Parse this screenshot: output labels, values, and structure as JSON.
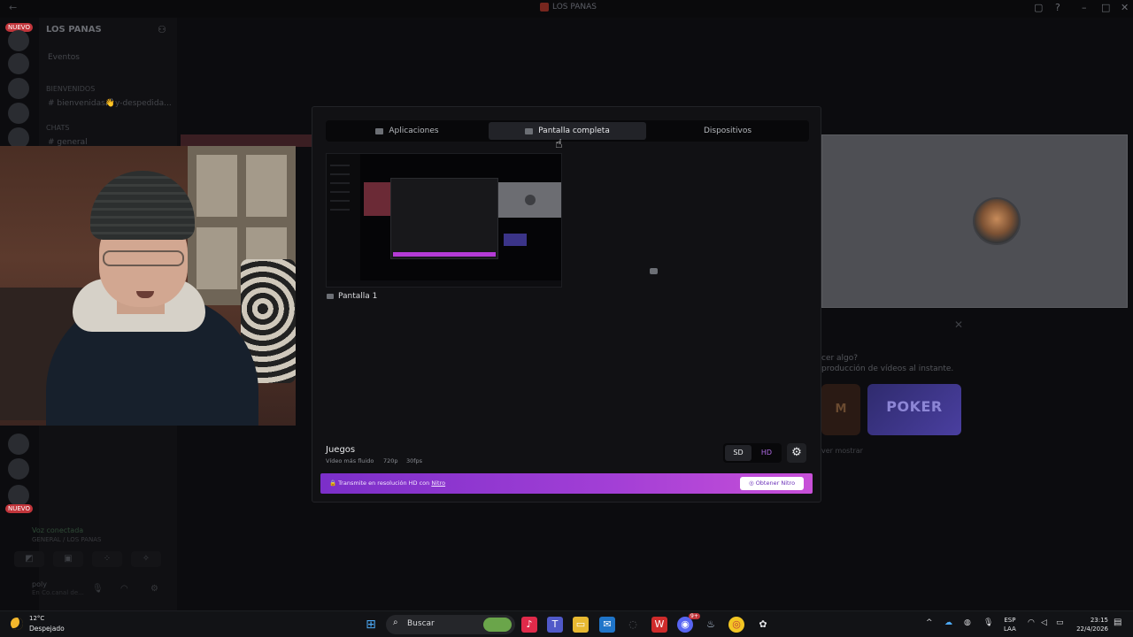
{
  "window": {
    "title": "LOS PANAS"
  },
  "sidebar": {
    "server_name": "LOS PANAS",
    "new_badge": "NUEVO",
    "new_badge_bottom": "NUEVO",
    "events": "Eventos",
    "category_welcome": "BIENVENIDOS",
    "welcome_channel": "bienvenidas👋y-despedida...",
    "category_chats": "CHATS",
    "general_channel": "general"
  },
  "voice_panel": {
    "status": "Voz conectada",
    "channel": "GENERAL / LOS PANAS",
    "username": "poly",
    "user_status": "En Co.canal de..."
  },
  "background": {
    "activity_line1": "cer algo?",
    "activity_line2": "producción de vídeos al instante.",
    "card1_text": "M",
    "card2_text": "POKER",
    "show_more": "ver mostrar"
  },
  "modal": {
    "tabs": [
      {
        "label": "Aplicaciones",
        "icon": "app-window-icon"
      },
      {
        "label": "Pantalla completa",
        "icon": "monitor-icon",
        "active": true
      },
      {
        "label": "Dispositivos",
        "icon": "camera-icon"
      }
    ],
    "screen_label": "Pantalla 1",
    "section_title": "Juegos",
    "quality_info": [
      "Vídeo más fluido",
      "720p",
      "30fps"
    ],
    "quality_options": {
      "sd": "SD",
      "hd": "HD",
      "selected": "SD"
    },
    "nitro_banner": {
      "text": "Transmite en resolución HD con",
      "link": "Nitro",
      "button": "Obtener Nitro"
    }
  },
  "taskbar": {
    "weather_temp": "12°C",
    "weather_condition": "Despejado",
    "search_placeholder": "Buscar",
    "language_line1": "ESP",
    "language_line2": "LAA",
    "time": "23:15",
    "date": "22/4/2026",
    "discord_badge": "9+"
  },
  "colors": {
    "nitro_gradient_start": "#7b2fc9",
    "nitro_gradient_end": "#c850d8",
    "hd_accent": "#b06be6",
    "modal_bg": "#111114"
  }
}
